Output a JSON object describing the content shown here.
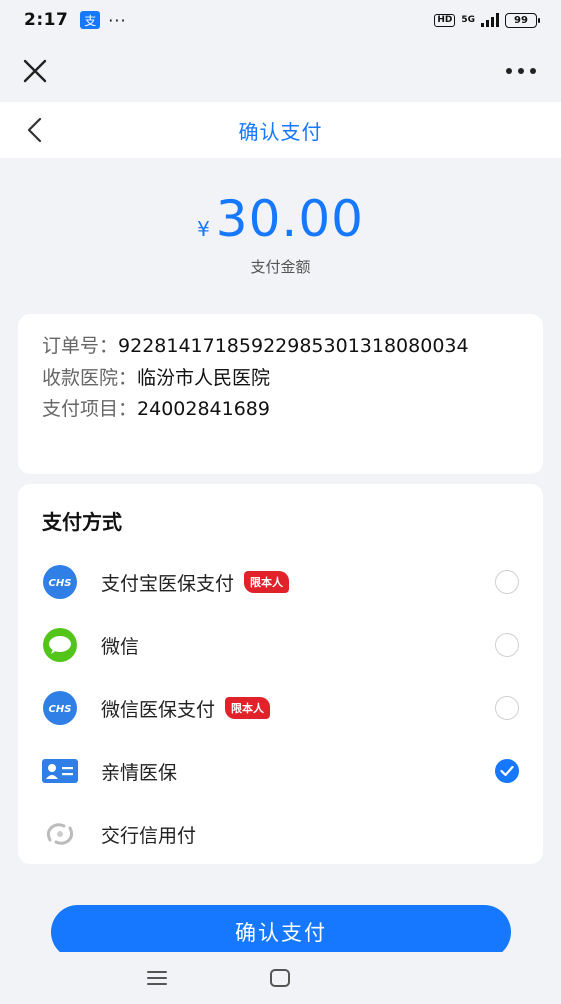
{
  "status_bar": {
    "time": "2:17",
    "app_badge": "支",
    "dots": "···",
    "hd": "HD",
    "network": "5G",
    "battery": "99"
  },
  "header": {
    "title": "确认支付"
  },
  "payment": {
    "currency": "¥",
    "amount": "30.00",
    "amount_label": "支付金额"
  },
  "order": {
    "rows": [
      {
        "key": "订单号：",
        "value": "92281417185922985301318080034"
      },
      {
        "key": "收款医院：",
        "value": "临汾市人民医院"
      },
      {
        "key": "支付项目：",
        "value": "24002841689"
      }
    ]
  },
  "methods": {
    "title": "支付方式",
    "items": [
      {
        "label": "支付宝医保支付",
        "badge": "限本人",
        "icon": "chs-icon",
        "checked": false
      },
      {
        "label": "微信",
        "badge": "",
        "icon": "wechat-icon",
        "checked": false
      },
      {
        "label": "微信医保支付",
        "badge": "限本人",
        "icon": "chs-icon",
        "checked": false
      },
      {
        "label": "亲情医保",
        "badge": "",
        "icon": "family-card-icon",
        "checked": true
      },
      {
        "label": "交行信用付",
        "badge": "",
        "icon": "bocom-icon",
        "checked": false
      }
    ],
    "chs_text": "CHS"
  },
  "actions": {
    "confirm_label": "确认支付"
  },
  "colors": {
    "accent": "#1677ff",
    "badge_red": "#e2222b",
    "wechat_green": "#52c41a"
  }
}
